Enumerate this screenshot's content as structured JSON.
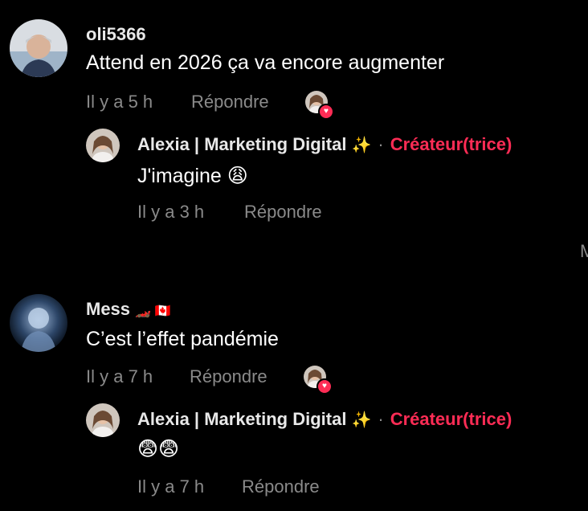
{
  "comments": [
    {
      "username": "oli5366",
      "text": "Attend en 2026 ça va encore augmenter",
      "time": "Il y a 5 h",
      "reply_label": "Répondre",
      "avatar_icon": "person-avatar-icon",
      "reply": {
        "username": "Alexia | Marketing Digital",
        "sparkle": "✨",
        "separator": "·",
        "badge": "Créateur(trice)",
        "text": "J'imagine",
        "emoji": "😩",
        "time": "Il y a 3 h",
        "reply_label": "Répondre"
      }
    },
    {
      "username": "Mess",
      "username_emojis": "🏎️ 🇨🇦",
      "text": "C’est l’effet pandémie",
      "time": "Il y a 7 h",
      "reply_label": "Répondre",
      "avatar_icon": "person-avatar-icon",
      "reply": {
        "username": "Alexia | Marketing Digital",
        "sparkle": "✨",
        "separator": "·",
        "badge": "Créateur(trice)",
        "emoji": "😨😨",
        "time": "Il y a 7 h",
        "reply_label": "Répondre"
      }
    }
  ],
  "edge_text": "M",
  "colors": {
    "background": "#000000",
    "creator_accent": "#fe2c55",
    "muted": "#8a8a8a",
    "sparkle": "#f5d33b"
  }
}
